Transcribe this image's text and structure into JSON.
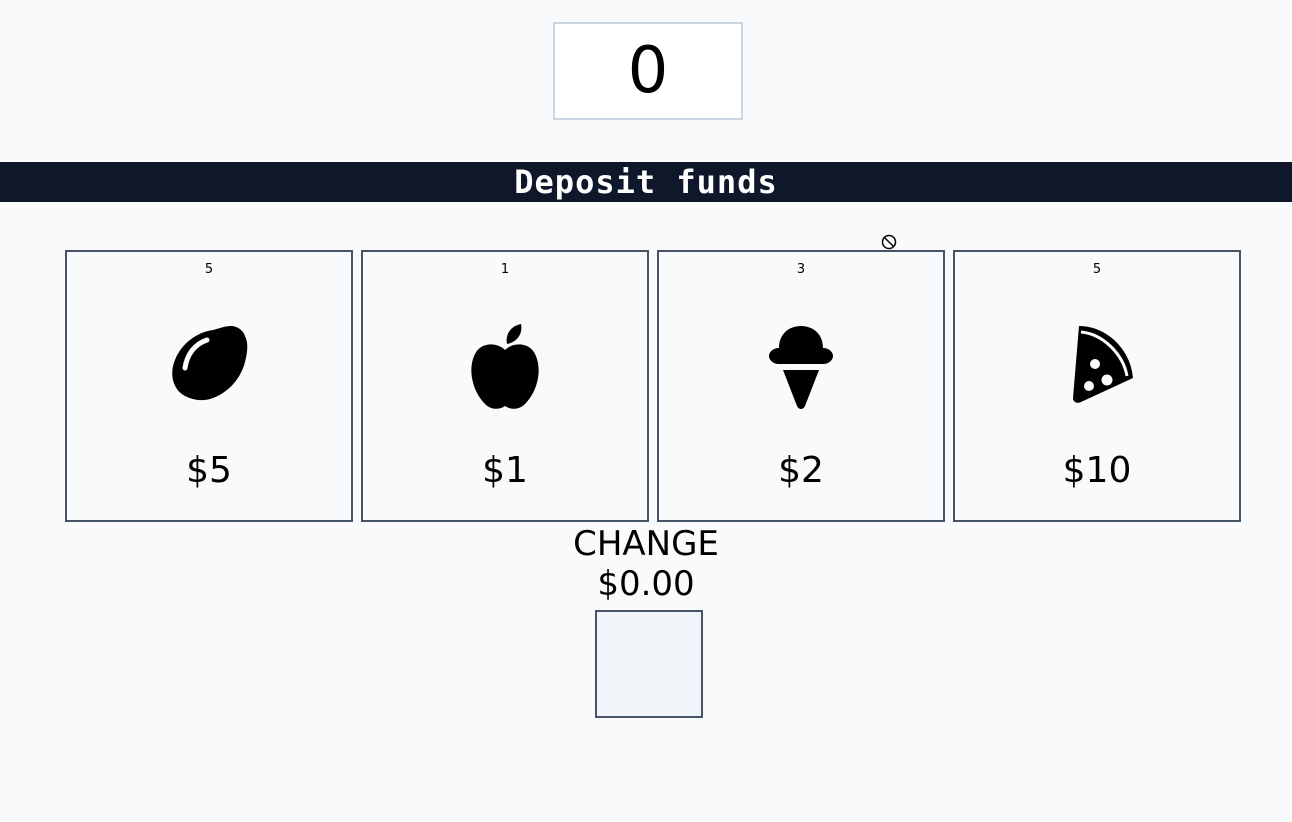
{
  "display": {
    "value": "0"
  },
  "banner": {
    "title": "Deposit funds"
  },
  "cursor": {
    "icon": "not-allowed-cursor-icon"
  },
  "products": [
    {
      "quantity": "5",
      "price": "$5",
      "icon": "lemon-icon"
    },
    {
      "quantity": "1",
      "price": "$1",
      "icon": "apple-icon"
    },
    {
      "quantity": "3",
      "price": "$2",
      "icon": "ice-cream-icon"
    },
    {
      "quantity": "5",
      "price": "$10",
      "icon": "pizza-slice-icon"
    }
  ],
  "change": {
    "label": "CHANGE",
    "amount": "$0.00"
  },
  "colors": {
    "background": "#f8fafc",
    "banner": "#0f172a",
    "card_border": "#475569",
    "display_border": "#cbd5e1",
    "tray_fill": "#f1f5f9"
  }
}
